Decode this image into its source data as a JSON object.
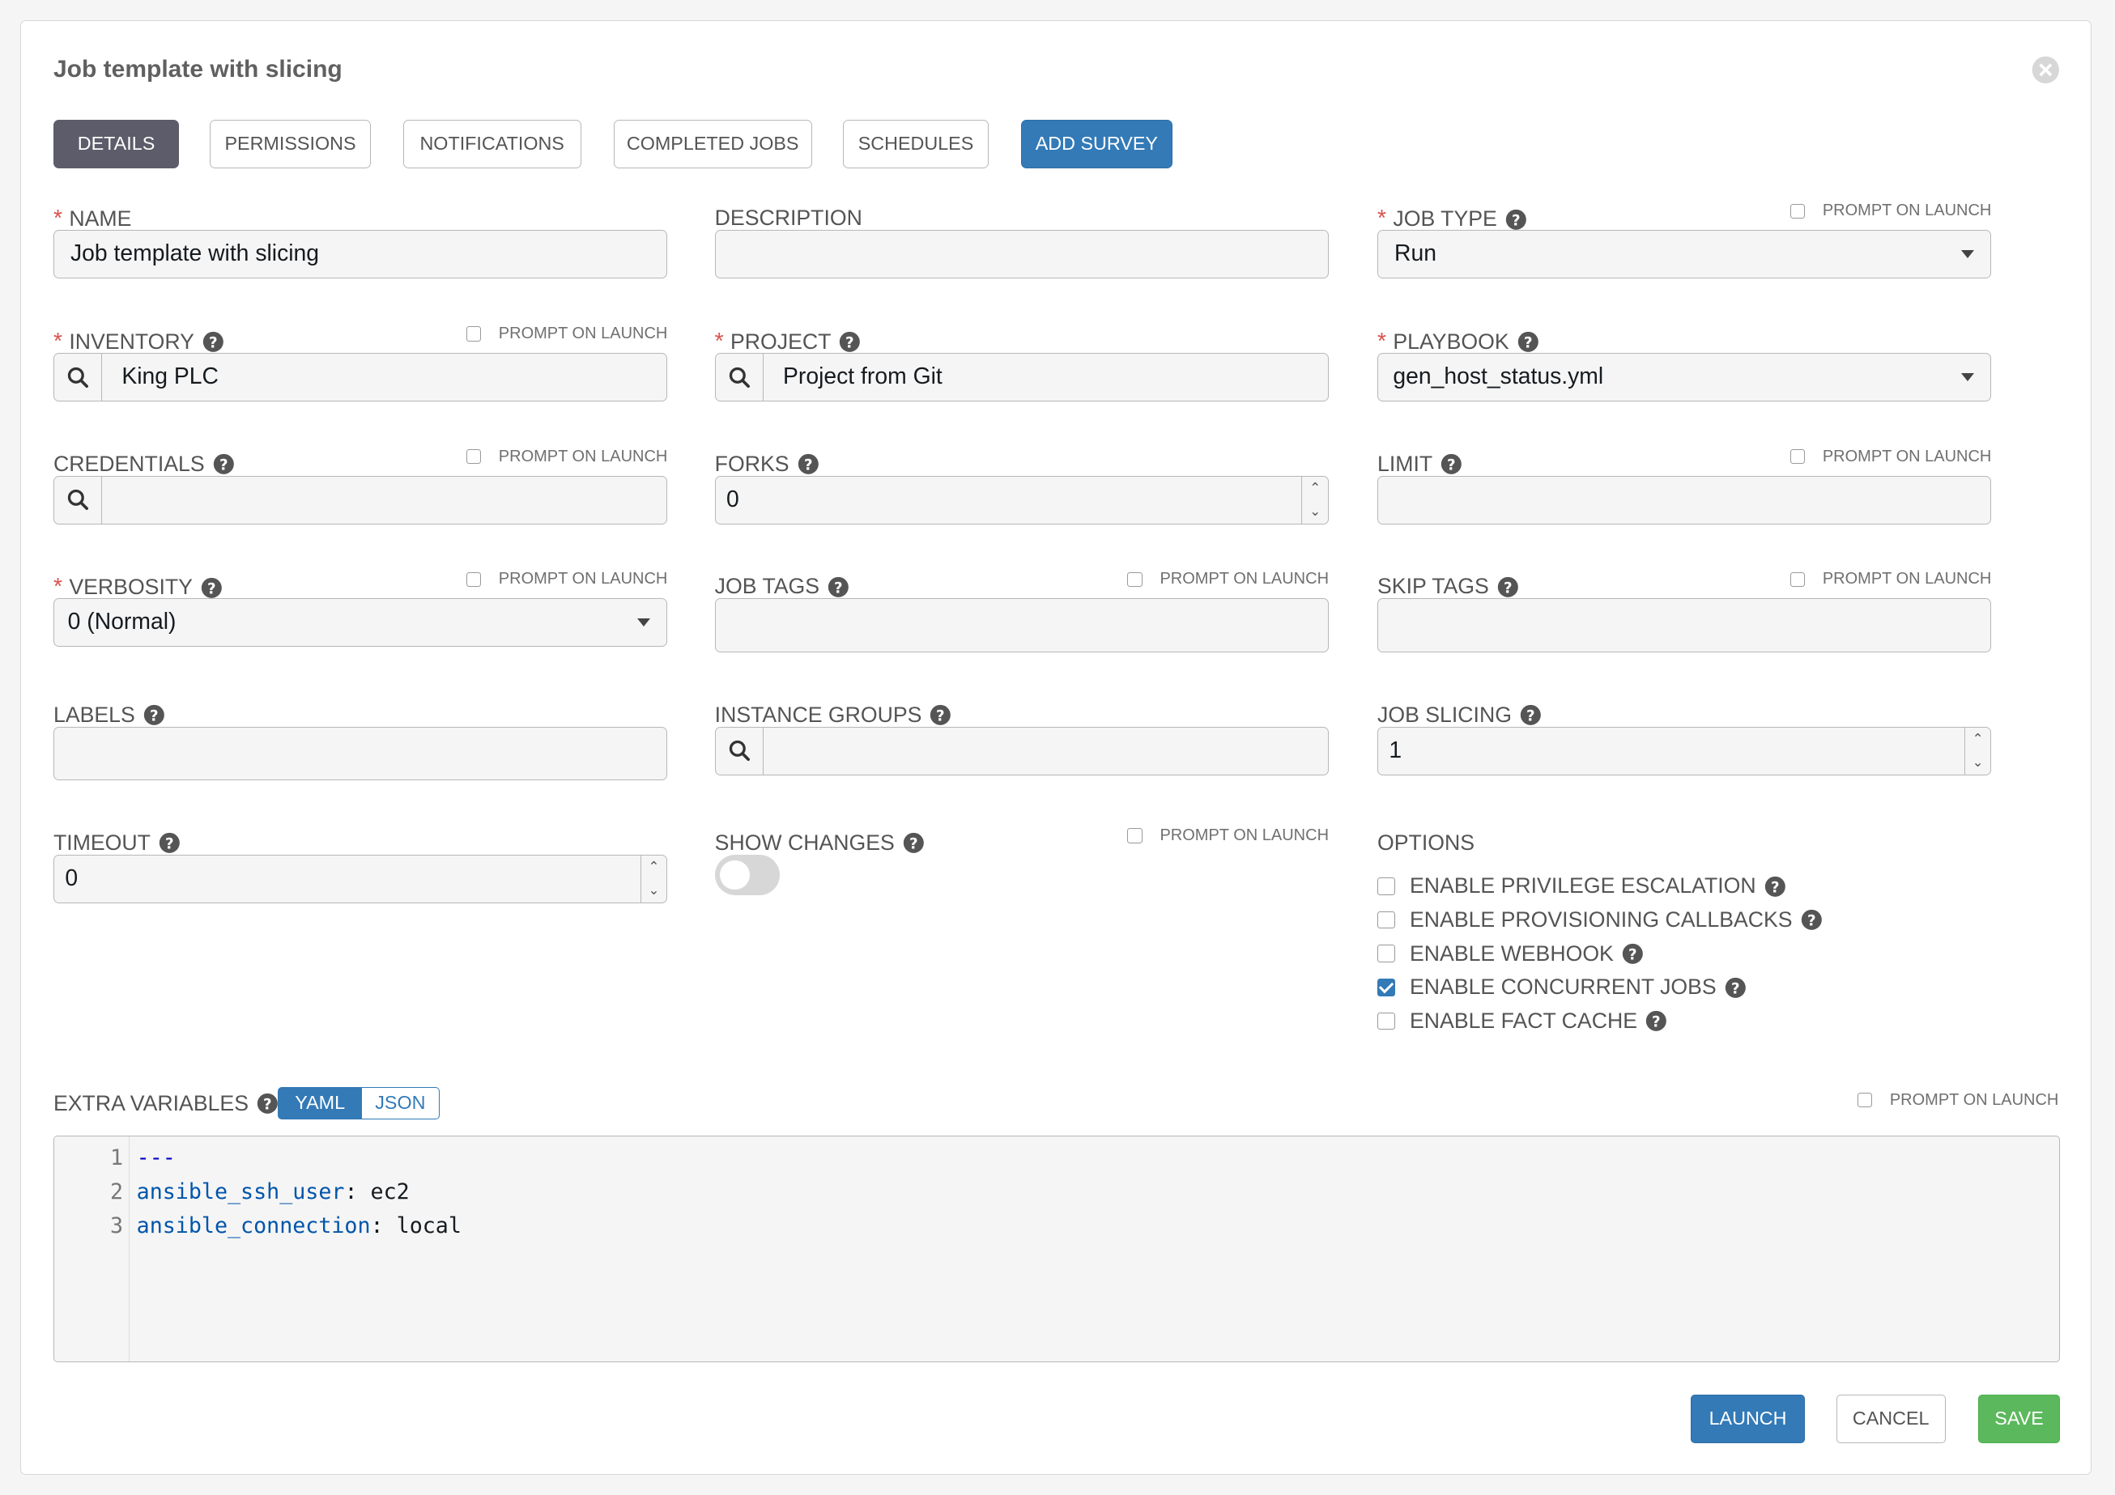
{
  "title": "Job template with slicing",
  "tabs": [
    {
      "label": "DETAILS"
    },
    {
      "label": "PERMISSIONS"
    },
    {
      "label": "NOTIFICATIONS"
    },
    {
      "label": "COMPLETED JOBS"
    },
    {
      "label": "SCHEDULES"
    },
    {
      "label": "ADD SURVEY"
    }
  ],
  "prompt_on_launch": "PROMPT ON LAUNCH",
  "fields": {
    "name": {
      "label": "NAME",
      "value": "Job template with slicing"
    },
    "description": {
      "label": "DESCRIPTION",
      "value": ""
    },
    "job_type": {
      "label": "JOB TYPE",
      "value": "Run"
    },
    "inventory": {
      "label": "INVENTORY",
      "value": "King PLC"
    },
    "project": {
      "label": "PROJECT",
      "value": "Project from Git"
    },
    "playbook": {
      "label": "PLAYBOOK",
      "value": "gen_host_status.yml"
    },
    "credentials": {
      "label": "CREDENTIALS",
      "value": ""
    },
    "forks": {
      "label": "FORKS",
      "value": "0"
    },
    "limit": {
      "label": "LIMIT",
      "value": ""
    },
    "verbosity": {
      "label": "VERBOSITY",
      "value": "0 (Normal)"
    },
    "job_tags": {
      "label": "JOB TAGS",
      "value": ""
    },
    "skip_tags": {
      "label": "SKIP TAGS",
      "value": ""
    },
    "labels": {
      "label": "LABELS",
      "value": ""
    },
    "instance_groups": {
      "label": "INSTANCE GROUPS",
      "value": ""
    },
    "job_slicing": {
      "label": "JOB SLICING",
      "value": "1"
    },
    "timeout": {
      "label": "TIMEOUT",
      "value": "0"
    },
    "show_changes": {
      "label": "SHOW CHANGES",
      "enabled": false
    }
  },
  "options": {
    "label": "OPTIONS",
    "items": [
      {
        "label": "ENABLE PRIVILEGE ESCALATION",
        "checked": false
      },
      {
        "label": "ENABLE PROVISIONING CALLBACKS",
        "checked": false
      },
      {
        "label": "ENABLE WEBHOOK",
        "checked": false
      },
      {
        "label": "ENABLE CONCURRENT JOBS",
        "checked": true
      },
      {
        "label": "ENABLE FACT CACHE",
        "checked": false
      }
    ]
  },
  "extra_variables": {
    "label": "EXTRA VARIABLES",
    "formats": {
      "yaml": "YAML",
      "json": "JSON"
    },
    "selected_format": "YAML",
    "line_numbers": [
      "1",
      "2",
      "3"
    ],
    "lines": [
      {
        "key": "---",
        "value": ""
      },
      {
        "key": "ansible_ssh_user",
        "value": "ec2"
      },
      {
        "key": "ansible_connection",
        "value": "local"
      }
    ]
  },
  "buttons": {
    "launch": "LAUNCH",
    "cancel": "CANCEL",
    "save": "SAVE"
  },
  "colors": {
    "primary": "#337ab7",
    "success": "#5cb85c",
    "required": "#d9534f",
    "active_tab": "#5c5c6a"
  }
}
